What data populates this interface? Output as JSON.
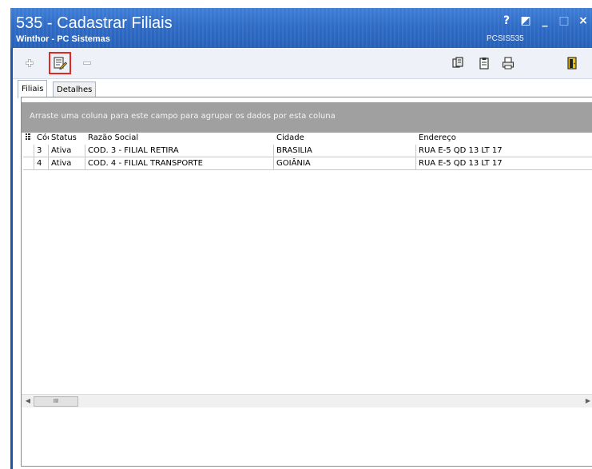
{
  "window": {
    "title": "535 - Cadastrar Filiais",
    "subtitle": "Winthor - PC Sistemas",
    "code": "PCSIS535",
    "controls": {
      "help": "?",
      "restore": "◩",
      "minimize": "_",
      "maximize": "□",
      "close": "×"
    }
  },
  "toolbar": {
    "left_icons": [
      "plus-icon",
      "edit-record-icon",
      "minus-icon"
    ],
    "right_icons": [
      "copy-icon",
      "clipboard-icon",
      "print-icon",
      "exit-door-icon"
    ]
  },
  "tabs": [
    {
      "label": "Filiais",
      "active": true
    },
    {
      "label": "Detalhes",
      "active": false
    }
  ],
  "grid": {
    "group_hint": "Arraste uma coluna para este campo para agrupar os dados por esta coluna",
    "columns": [
      "Cód",
      "Status",
      "Razão Social",
      "Cidade",
      "Endereço"
    ],
    "rows": [
      [
        "3",
        "Ativa",
        "COD. 3 - FILIAL RETIRA",
        "BRASILIA",
        "RUA E-5 QD 13 LT 17"
      ],
      [
        "4",
        "Ativa",
        "COD. 4 - FILIAL TRANSPORTE",
        "GOIÂNIA",
        "RUA E-5 QD 13 LT 17"
      ]
    ]
  },
  "scrollbar": {
    "thumb_label": "III"
  },
  "colors": {
    "titlebar": "#2f6cc6",
    "highlight": "#e2281f",
    "group_panel": "#a0a0a0"
  }
}
